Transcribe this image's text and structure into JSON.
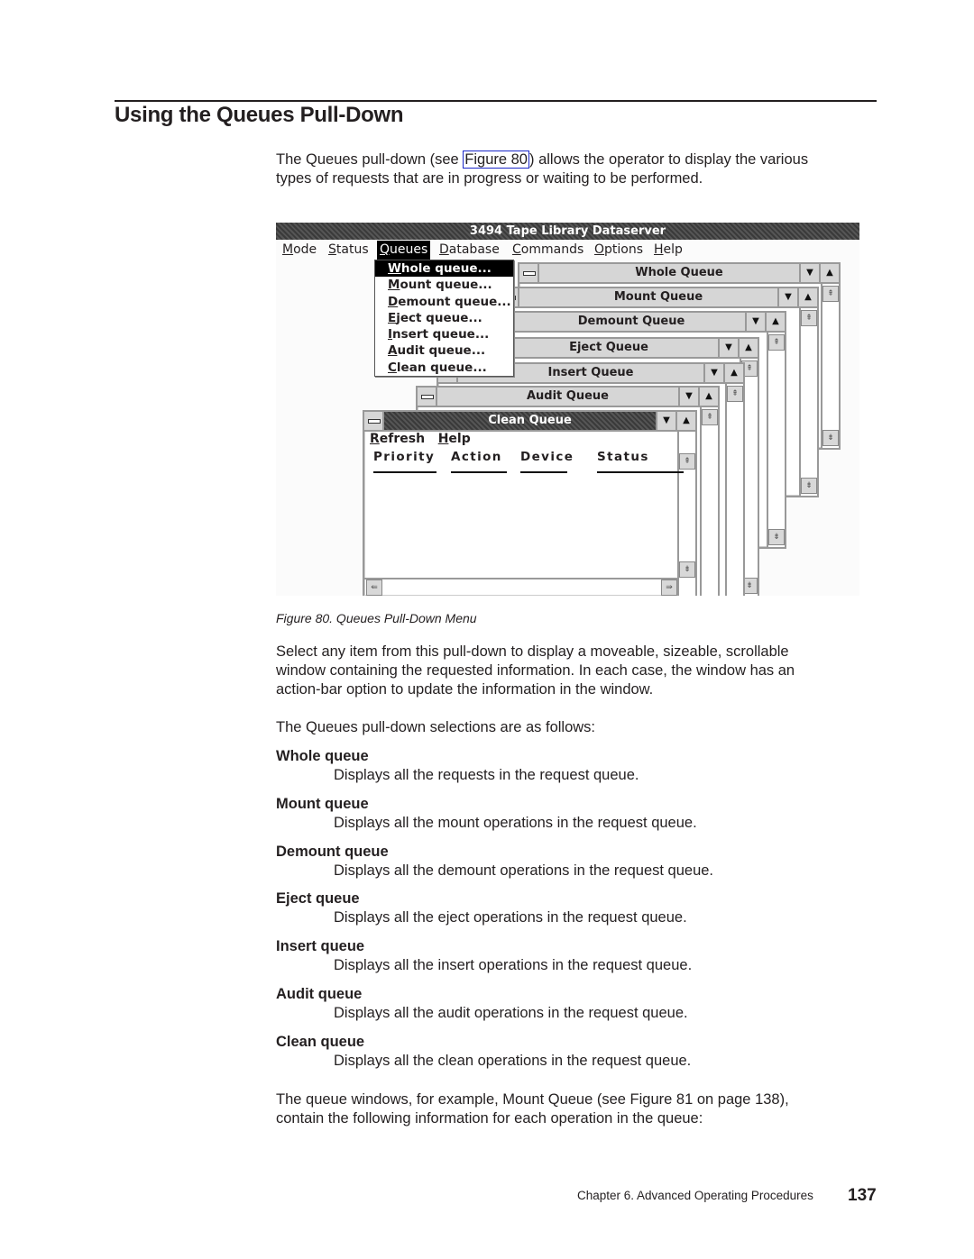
{
  "page": {
    "section_title": "Using the Queues Pull-Down",
    "intro": {
      "before_link": "The Queues pull-down (see ",
      "link_text": "Figure 80",
      "after_link": ") allows the operator to display the various",
      "line2": "types of requests that are in progress or waiting to be performed."
    },
    "figure_caption": "Figure 80. Queues Pull-Down Menu",
    "para2": [
      "Select any item from this pull-down to display a moveable, sizeable, scrollable",
      "window containing the requested information. In each case, the window has an",
      "action-bar option to update the information in the window."
    ],
    "para3": "The Queues pull-down selections are as follows:",
    "definitions": [
      {
        "term": "Whole queue",
        "desc": "Displays all the requests in the request queue."
      },
      {
        "term": "Mount queue",
        "desc": "Displays all the mount operations in the request queue."
      },
      {
        "term": "Demount queue",
        "desc": "Displays all the demount operations in the request queue."
      },
      {
        "term": "Eject queue",
        "desc": "Displays all the eject operations in the request queue."
      },
      {
        "term": "Insert queue",
        "desc": "Displays all the insert operations in the request queue."
      },
      {
        "term": "Audit queue",
        "desc": "Displays all the audit operations in the request queue."
      },
      {
        "term": "Clean queue",
        "desc": "Displays all the clean operations in the request queue."
      }
    ],
    "para4": [
      "The queue windows, for example, Mount Queue (see Figure 81 on page 138),",
      "contain the following information for each operation in the queue:"
    ],
    "footer": {
      "chapter": "Chapter 6. Advanced Operating Procedures",
      "page_number": "137"
    }
  },
  "screen": {
    "app_title": "3494 Tape Library Dataserver",
    "menubar": [
      "Mode",
      "Status",
      "Queues",
      "Database",
      "Commands",
      "Options",
      "Help"
    ],
    "active_menu": "Queues",
    "dropdown": [
      "Whole queue...",
      "Mount queue...",
      "Demount queue...",
      "Eject queue...",
      "Insert queue...",
      "Audit queue...",
      "Clean queue..."
    ],
    "selected_dropdown_item": "Whole queue...",
    "windows": [
      "Whole Queue",
      "Mount Queue",
      "Demount Queue",
      "Eject Queue",
      "Insert Queue",
      "Audit Queue",
      "Clean Queue"
    ],
    "active_window": {
      "title": "Clean Queue",
      "menu": [
        "Refresh",
        "Help"
      ],
      "columns": [
        "Priority",
        "Action",
        "Device",
        "Status"
      ]
    },
    "icons": {
      "min": "▼",
      "max": "▲",
      "scroll_up": "⇞",
      "scroll_down": "⇟",
      "scroll_left": "⇚",
      "scroll_right": "⇛"
    }
  }
}
